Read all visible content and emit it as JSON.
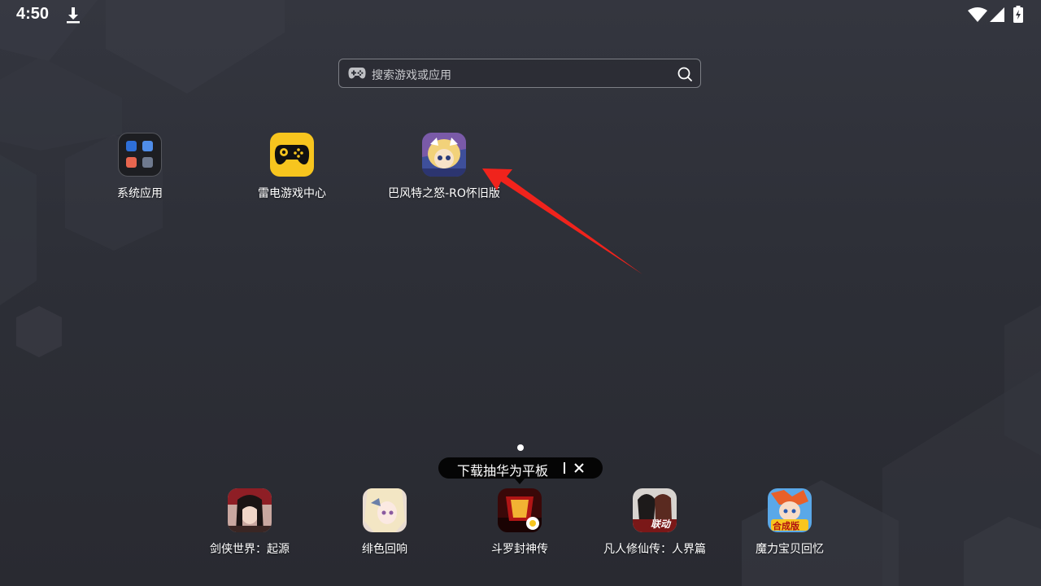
{
  "status_bar": {
    "time": "4:50",
    "icons": [
      "download-icon",
      "wifi-icon",
      "signal-icon",
      "battery-charging-icon"
    ]
  },
  "search": {
    "placeholder": "搜索游戏或应用",
    "left_icon": "gamepad-icon",
    "right_icon": "search-icon"
  },
  "desktop_apps": [
    {
      "label": "系统应用",
      "icon": "folder-icon"
    },
    {
      "label": "雷电游戏中心",
      "icon": "gamepad-icon"
    },
    {
      "label": "巴风特之怒-RO怀旧版",
      "icon": "game-art-icon"
    }
  ],
  "tooltip": {
    "text": "下载抽华为平板"
  },
  "dock_apps": [
    {
      "label": "剑侠世界：起源"
    },
    {
      "label": "绯色回响"
    },
    {
      "label": "斗罗封神传"
    },
    {
      "label": "凡人修仙传：人界篇",
      "badge": "联动"
    },
    {
      "label": "魔力宝贝回忆",
      "badge": "合成版"
    }
  ],
  "colors": {
    "background": "#2d2f37",
    "accent_yellow": "#f7c51e",
    "arrow_red": "#f0231c",
    "tooltip_bg": "#050505"
  }
}
